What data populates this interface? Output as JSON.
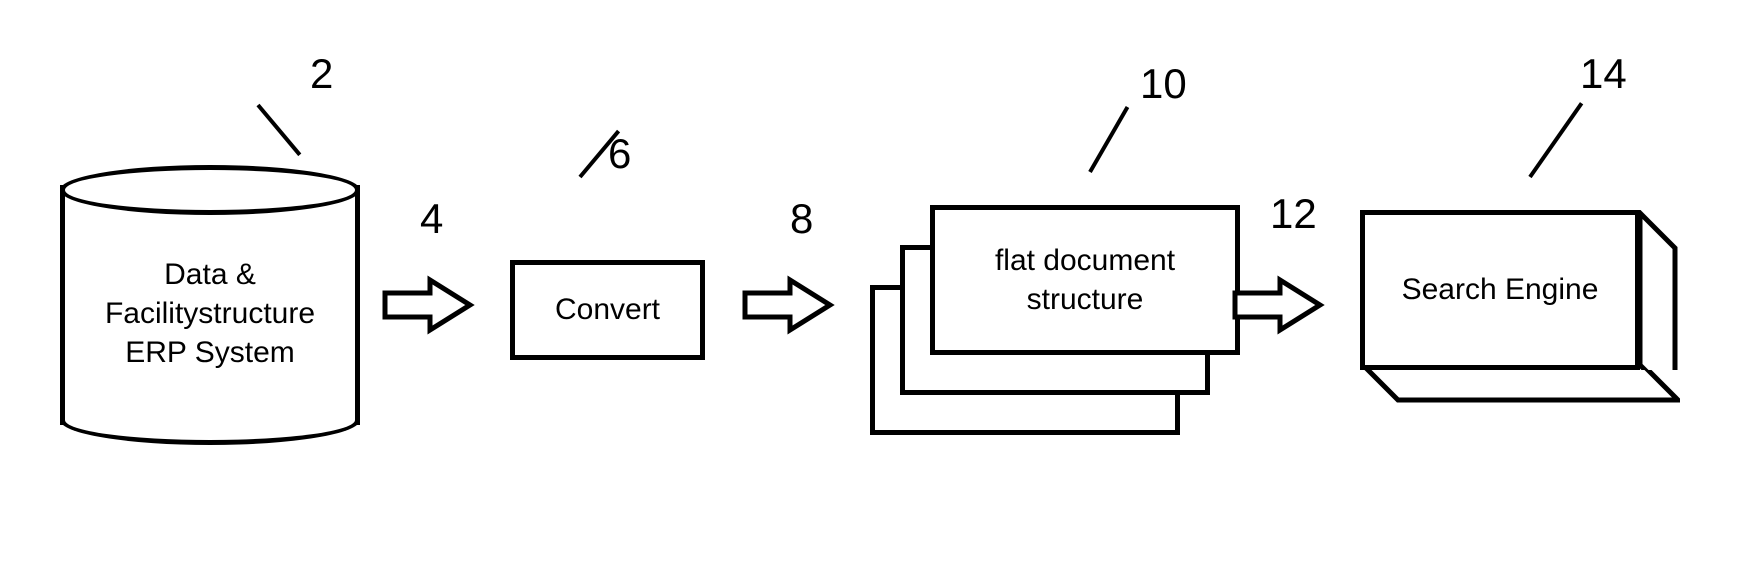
{
  "nodes": {
    "erp_system": {
      "label_line1": "Data &",
      "label_line2": "Facilitystructure",
      "label_line3": "ERP System",
      "ref": "2"
    },
    "arrow_1": {
      "ref": "4"
    },
    "convert": {
      "label": "Convert",
      "ref": "6"
    },
    "arrow_2": {
      "ref": "8"
    },
    "flat_doc": {
      "label_line1": "flat document",
      "label_line2": "structure",
      "ref": "10"
    },
    "arrow_3": {
      "ref": "12"
    },
    "search_engine": {
      "label": "Search Engine",
      "ref": "14"
    }
  }
}
